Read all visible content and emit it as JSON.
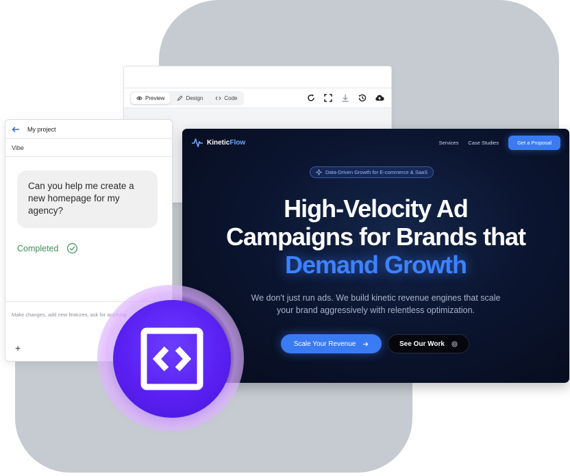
{
  "editor": {
    "tabs": [
      {
        "label": "Preview",
        "icon": "eye-icon"
      },
      {
        "label": "Design",
        "icon": "pencil-icon"
      },
      {
        "label": "Code",
        "icon": "code-icon"
      }
    ],
    "toolbar_icons": [
      "refresh-icon",
      "fullscreen-icon",
      "download-icon",
      "history-icon",
      "cloud-upload-icon"
    ]
  },
  "chat": {
    "title": "My project",
    "subtitle": "Vibe",
    "message": "Can you help me create a new homepage for my agency?",
    "status": "Completed",
    "input_placeholder": "Make changes, add new features, ask for anything",
    "plus_label": "+"
  },
  "site": {
    "brand_kinetic": "Kinetic",
    "brand_flow": "Flow",
    "nav": [
      "Services",
      "Case Studies"
    ],
    "cta": "Get a Proposal",
    "pill": "Data-Driven Growth for E-commerce & SaaS",
    "hero_line1": "High-Velocity Ad",
    "hero_line2": "Campaigns for Brands that",
    "hero_accent": "Demand Growth",
    "sub_line1": "We don't just run ads. We build kinetic revenue engines that scale",
    "sub_line2": "your brand aggressively with relentless optimization.",
    "primary_button": "Scale Your Revenue",
    "secondary_button": "See Our Work"
  },
  "colors": {
    "accent_blue": "#3a7bf4",
    "logo_purple": "#5a20f2",
    "completed_green": "#3c8e5a",
    "background_gray": "#c5cbd0"
  },
  "logo_icon": "code-brackets-icon"
}
